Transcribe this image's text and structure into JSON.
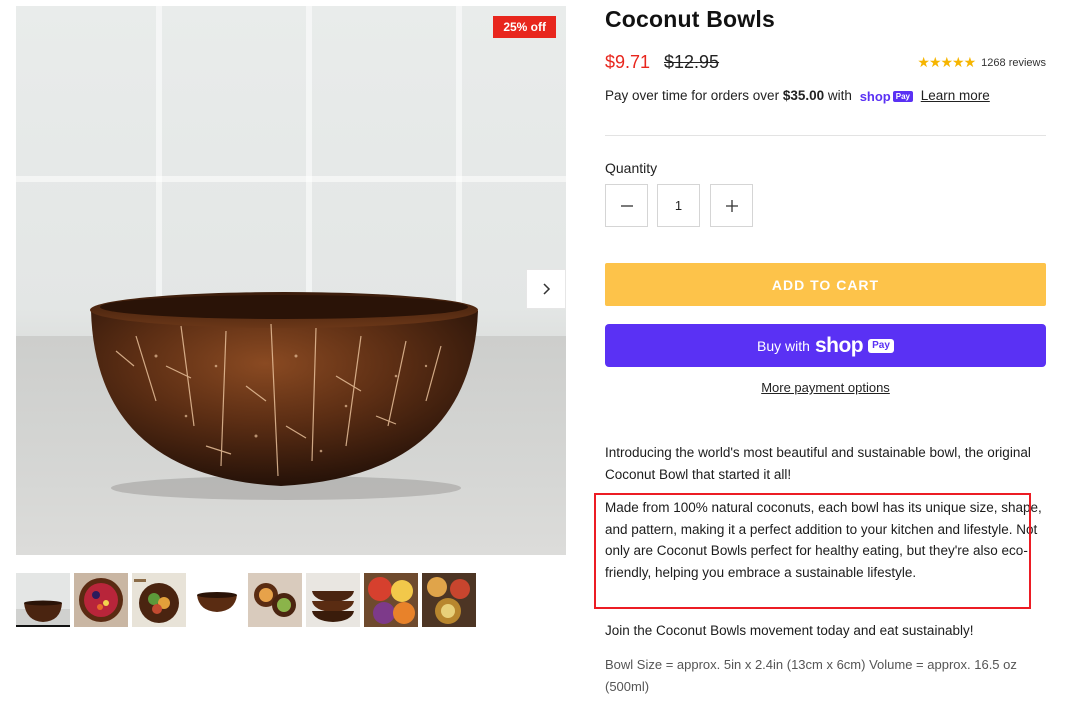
{
  "gallery": {
    "badge": "25% off",
    "next_icon": "chevron-right-icon",
    "main_image": "coconut-bowl-photo",
    "thumbnails": [
      {
        "name": "coconut-bowl-photo",
        "active": true
      },
      {
        "name": "smoothie-bowl-photo",
        "active": false
      },
      {
        "name": "salad-bowl-photo",
        "active": false
      },
      {
        "name": "bowl-white-background-photo",
        "active": false
      },
      {
        "name": "bowls-in-hands-photo",
        "active": false
      },
      {
        "name": "stacked-bowls-photo",
        "active": false
      },
      {
        "name": "fruit-bowls-photo",
        "active": false
      },
      {
        "name": "table-spread-photo",
        "active": false
      }
    ]
  },
  "product": {
    "title": "Coconut Bowls",
    "price_sale": "$9.71",
    "price_compare": "$12.95",
    "rating_stars": "★★★★★",
    "reviews": "1268 reviews",
    "installments": {
      "prefix": "Pay over time for orders over",
      "amount": "$35.00",
      "with": "with",
      "shop_word": "shop",
      "pay_chip": "Pay",
      "learn_more": "Learn more"
    },
    "quantity_label": "Quantity",
    "quantity_value": "1",
    "add_to_cart": "ADD TO CART",
    "buy_with": "Buy with",
    "buy_shop_word": "shop",
    "buy_pay_chip": "Pay",
    "more_payment": "More payment options",
    "description": {
      "intro": "Introducing the world's most beautiful and sustainable bowl, the original Coconut Bowl that started it all!",
      "body": "Made from 100% natural coconuts, each bowl has its unique size, shape, and pattern, making it a perfect addition to your kitchen and lifestyle. Not only are Coconut Bowls perfect for healthy eating, but they're also eco-friendly, helping you embrace a sustainable lifestyle.",
      "cta": "Join the Coconut Bowls movement today and eat sustainably!",
      "specs": "Bowl Size = approx. 5in x 2.4in (13cm x 6cm) Volume = approx. 16.5 oz (500ml)"
    }
  },
  "colors": {
    "sale_red": "#e8261d",
    "add_to_cart_yellow": "#fdc34a",
    "shop_pay_purple": "#5a31f4",
    "highlight_red": "#ec1c24",
    "star_gold": "#f6b500"
  }
}
